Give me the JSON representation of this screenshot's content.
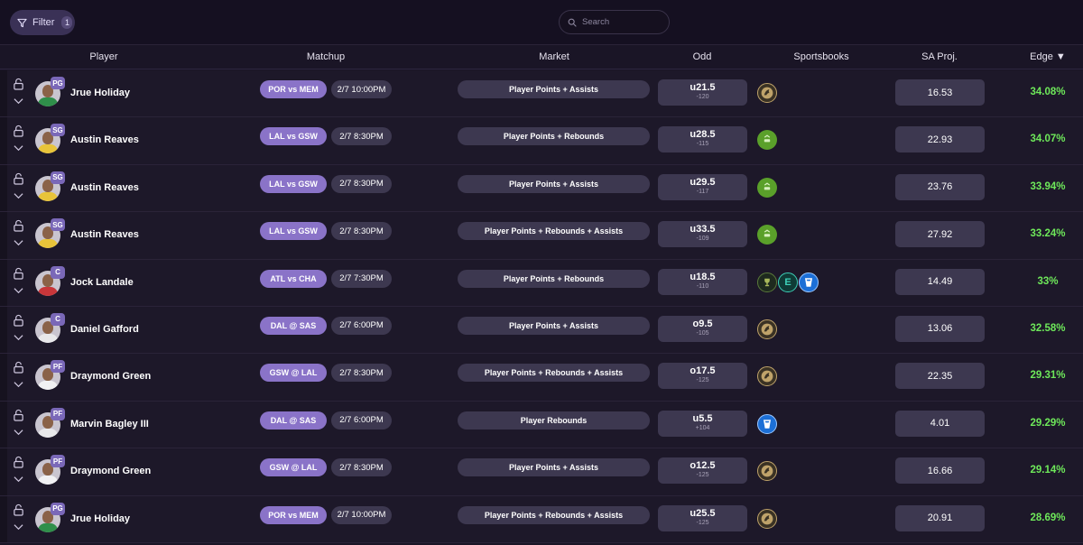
{
  "toolbar": {
    "filter_label": "Filter",
    "filter_count": "1",
    "search_placeholder": "Search"
  },
  "columns": {
    "player": "Player",
    "matchup": "Matchup",
    "market": "Market",
    "odd": "Odd",
    "sportsbooks": "Sportsbooks",
    "proj": "SA Proj.",
    "edge": "Edge ▼"
  },
  "colors": {
    "accent": "#8a73c8",
    "edge_positive": "#6ee85a",
    "pill": "#3d3850",
    "background": "#1a1526"
  },
  "rows": [
    {
      "pos": "PG",
      "name": "Jrue Holiday",
      "matchup": "POR vs MEM",
      "date": "2/7 10:00PM",
      "market": "Player Points + Assists",
      "line": "u21.5",
      "price": "-120",
      "books": [
        "betmgm"
      ],
      "proj": "16.53",
      "edge": "34.08%",
      "jersey": "#2f8f4a"
    },
    {
      "pos": "SG",
      "name": "Austin Reaves",
      "matchup": "LAL vs GSW",
      "date": "2/7 8:30PM",
      "market": "Player Points + Rebounds",
      "line": "u28.5",
      "price": "-115",
      "books": [
        "draftkings"
      ],
      "proj": "22.93",
      "edge": "34.07%",
      "jersey": "#e8c43a"
    },
    {
      "pos": "SG",
      "name": "Austin Reaves",
      "matchup": "LAL vs GSW",
      "date": "2/7 8:30PM",
      "market": "Player Points + Assists",
      "line": "u29.5",
      "price": "-117",
      "books": [
        "draftkings"
      ],
      "proj": "23.76",
      "edge": "33.94%",
      "jersey": "#e8c43a"
    },
    {
      "pos": "SG",
      "name": "Austin Reaves",
      "matchup": "LAL vs GSW",
      "date": "2/7 8:30PM",
      "market": "Player Points + Rebounds + Assists",
      "line": "u33.5",
      "price": "-109",
      "books": [
        "draftkings"
      ],
      "proj": "27.92",
      "edge": "33.24%",
      "jersey": "#e8c43a"
    },
    {
      "pos": "C",
      "name": "Jock Landale",
      "matchup": "ATL vs CHA",
      "date": "2/7 7:30PM",
      "market": "Player Points + Rebounds",
      "line": "u18.5",
      "price": "-110",
      "books": [
        "trophy",
        "espnbet",
        "fanduel"
      ],
      "proj": "14.49",
      "edge": "33%",
      "jersey": "#c8363a"
    },
    {
      "pos": "C",
      "name": "Daniel Gafford",
      "matchup": "DAL @ SAS",
      "date": "2/7 6:00PM",
      "market": "Player Points + Assists",
      "line": "o9.5",
      "price": "-105",
      "books": [
        "betmgm"
      ],
      "proj": "13.06",
      "edge": "32.58%",
      "jersey": "#e8e8ea"
    },
    {
      "pos": "PF",
      "name": "Draymond Green",
      "matchup": "GSW @ LAL",
      "date": "2/7 8:30PM",
      "market": "Player Points + Rebounds + Assists",
      "line": "o17.5",
      "price": "-125",
      "books": [
        "betmgm"
      ],
      "proj": "22.35",
      "edge": "29.31%",
      "jersey": "#f1f1f3"
    },
    {
      "pos": "PF",
      "name": "Marvin Bagley III",
      "matchup": "DAL @ SAS",
      "date": "2/7 6:00PM",
      "market": "Player Rebounds",
      "line": "u5.5",
      "price": "+104",
      "books": [
        "fanduel"
      ],
      "proj": "4.01",
      "edge": "29.29%",
      "jersey": "#e8e8ea"
    },
    {
      "pos": "PF",
      "name": "Draymond Green",
      "matchup": "GSW @ LAL",
      "date": "2/7 8:30PM",
      "market": "Player Points + Assists",
      "line": "o12.5",
      "price": "-125",
      "books": [
        "betmgm"
      ],
      "proj": "16.66",
      "edge": "29.14%",
      "jersey": "#f1f1f3"
    },
    {
      "pos": "PG",
      "name": "Jrue Holiday",
      "matchup": "POR vs MEM",
      "date": "2/7 10:00PM",
      "market": "Player Points + Rebounds + Assists",
      "line": "u25.5",
      "price": "-125",
      "books": [
        "betmgm"
      ],
      "proj": "20.91",
      "edge": "28.69%",
      "jersey": "#2f8f4a"
    }
  ]
}
